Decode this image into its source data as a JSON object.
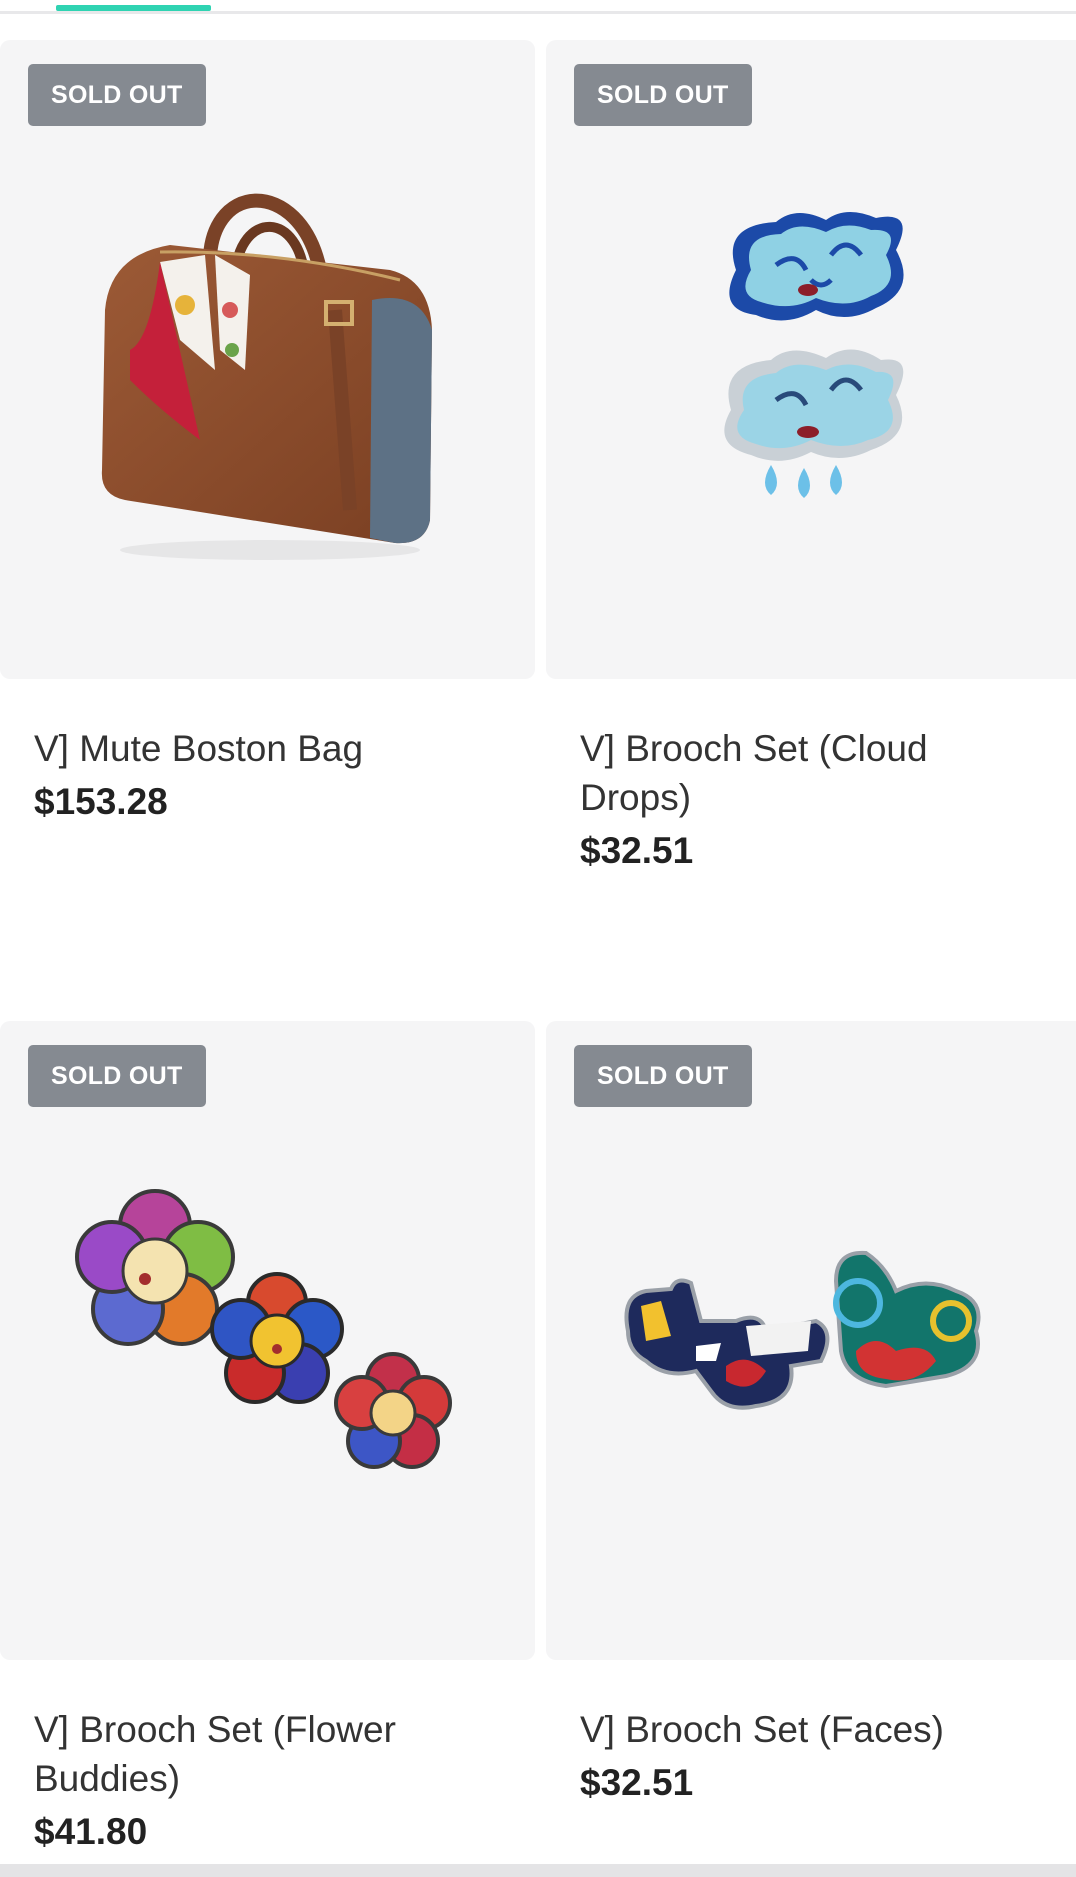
{
  "tabs": {
    "active_indicator_color": "#2fd3b2"
  },
  "products": [
    {
      "name": "V] Mute Boston Bag",
      "price": "$153.28",
      "badge": "SOLD OUT",
      "image_icon": "boston-bag"
    },
    {
      "name": "V] Brooch Set (Cloud Drops)",
      "price": "$32.51",
      "badge": "SOLD OUT",
      "image_icon": "cloud-brooch"
    },
    {
      "name": "V] Brooch Set (Flower Buddies)",
      "price": "$41.80",
      "badge": "SOLD OUT",
      "image_icon": "flower-brooch"
    },
    {
      "name": "V] Brooch Set (Faces)",
      "price": "$32.51",
      "badge": "SOLD OUT",
      "image_icon": "faces-brooch"
    }
  ],
  "colors": {
    "badge_bg": "#858a91",
    "card_bg": "#f5f5f6",
    "accent": "#2fd3b2"
  }
}
